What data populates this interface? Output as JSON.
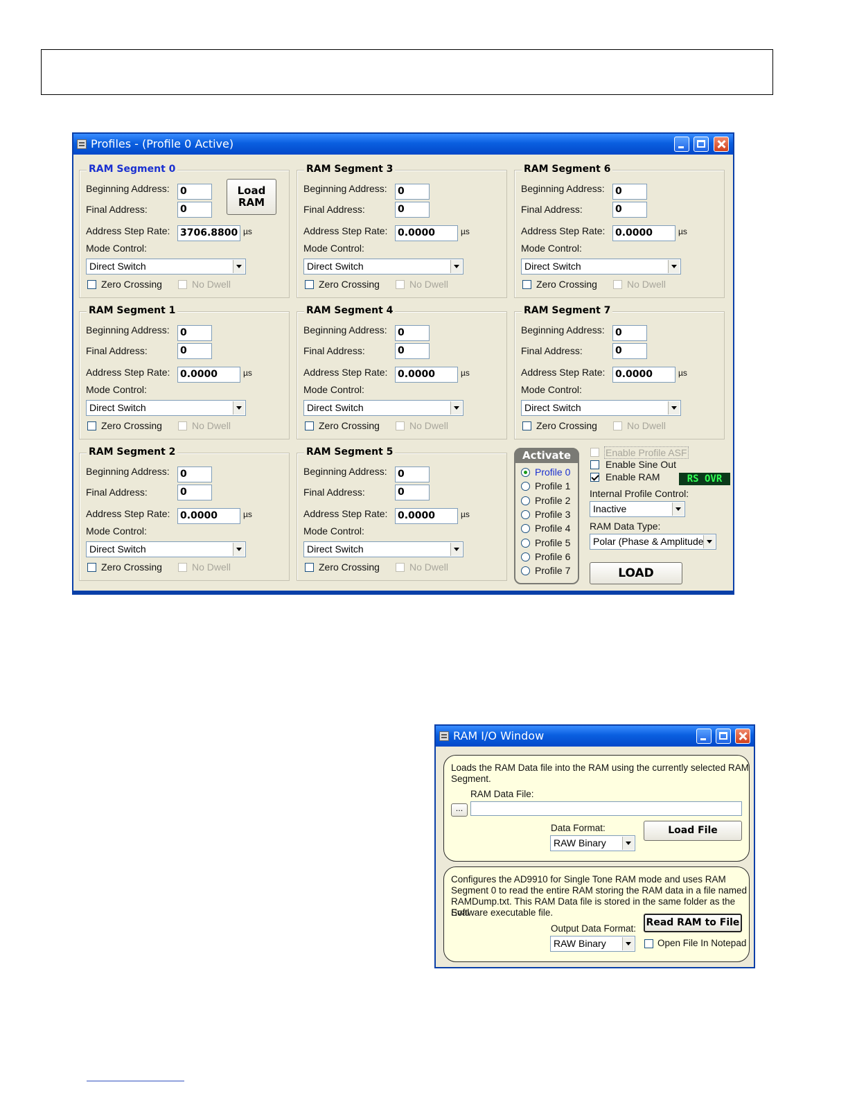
{
  "profiles_window": {
    "title": "Profiles - (Profile 0 Active)",
    "load_ram_line1": "Load",
    "load_ram_line2": "RAM",
    "labels": {
      "beginning": "Beginning Address:",
      "final": "Final Address:",
      "step": "Address Step Rate:",
      "unit": "µs",
      "mode": "Mode Control:",
      "zero": "Zero Crossing",
      "nodwell": "No Dwell"
    },
    "segments": [
      {
        "title": "RAM Segment 0",
        "beginning": "0",
        "final": "0",
        "step": "3706.8800",
        "mode": "Direct Switch"
      },
      {
        "title": "RAM Segment 1",
        "beginning": "0",
        "final": "0",
        "step": "0.0000",
        "mode": "Direct Switch"
      },
      {
        "title": "RAM Segment 2",
        "beginning": "0",
        "final": "0",
        "step": "0.0000",
        "mode": "Direct Switch"
      },
      {
        "title": "RAM Segment 3",
        "beginning": "0",
        "final": "0",
        "step": "0.0000",
        "mode": "Direct Switch"
      },
      {
        "title": "RAM Segment 4",
        "beginning": "0",
        "final": "0",
        "step": "0.0000",
        "mode": "Direct Switch"
      },
      {
        "title": "RAM Segment 5",
        "beginning": "0",
        "final": "0",
        "step": "0.0000",
        "mode": "Direct Switch"
      },
      {
        "title": "RAM Segment 6",
        "beginning": "0",
        "final": "0",
        "step": "0.0000",
        "mode": "Direct Switch"
      },
      {
        "title": "RAM Segment 7",
        "beginning": "0",
        "final": "0",
        "step": "0.0000",
        "mode": "Direct Switch"
      }
    ],
    "activate": {
      "title": "Activate",
      "profiles": [
        "Profile 0",
        "Profile 1",
        "Profile 2",
        "Profile 3",
        "Profile 4",
        "Profile 5",
        "Profile 6",
        "Profile 7"
      ],
      "selected": "Profile 0"
    },
    "options": {
      "enable_profile_asf": "Enable Profile ASF",
      "enable_sine_out": "Enable Sine Out",
      "enable_ram": "Enable RAM",
      "rs_ovr": "RS OVR",
      "internal_profile_label": "Internal Profile Control:",
      "internal_profile_value": "Inactive",
      "ram_data_type_label": "RAM Data Type:",
      "ram_data_type_value": "Polar (Phase & Amplitude)",
      "load_button": "LOAD"
    }
  },
  "ramio_window": {
    "title": "RAM I/O Window",
    "load_desc_1": "Loads the RAM Data file into the RAM using the currently selected RAM",
    "load_desc_2": "Segment.",
    "file_label": "RAM Data File:",
    "browse_label": "...",
    "file_value": "",
    "format_label": "Data Format:",
    "format_value": "RAW Binary",
    "load_file_button": "Load File",
    "read_desc_1": "Configures the AD9910 for Single Tone RAM mode and uses RAM",
    "read_desc_2": "Segment 0 to read the entire RAM storing the RAM data in a file named",
    "read_desc_3": "RAMDump.txt. This RAM Data file is stored in the same folder as the Eval",
    "read_desc_4": "Software executable file.",
    "output_format_label": "Output Data Format:",
    "output_format_value": "RAW Binary",
    "read_button": "Read RAM to File",
    "open_notepad": "Open File In Notepad"
  },
  "colors": {
    "title_bar": "#0a5fe0",
    "dialog_bg": "#ece9d8",
    "panel_bg": "#ffffe0",
    "segment0_title": "#1a30d0",
    "rs_ovr_text": "#33ff55"
  }
}
